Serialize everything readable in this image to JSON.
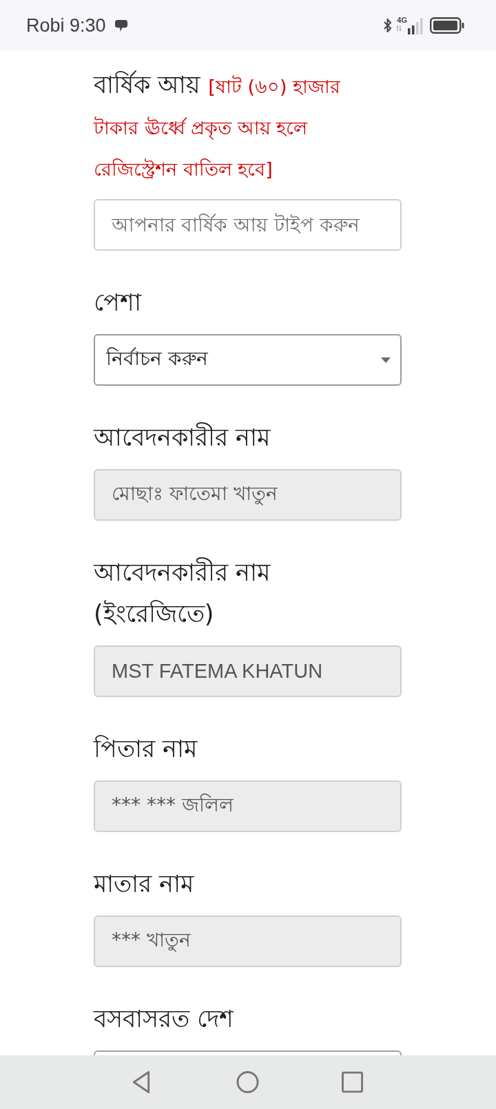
{
  "status_bar": {
    "carrier_time": "Robi 9:30",
    "network": "4G"
  },
  "form": {
    "fields": [
      {
        "label": "বার্ষিক আয়",
        "note": "[ষাট (৬০) হাজার টাকার ঊর্ধ্বে প্রকৃত আয় হলে রেজিস্ট্রেশন বাতিল হবে]",
        "input": {
          "kind": "text",
          "placeholder": "আপনার বার্ষিক আয় টাইপ করুন",
          "disabled": false
        }
      },
      {
        "label": "পেশা",
        "input": {
          "kind": "select",
          "value": "নির্বাচন করুন",
          "disabled": false
        }
      },
      {
        "label": "আবেদনকারীর নাম",
        "input": {
          "kind": "text",
          "value": "মোছাঃ ফাতেমা খাতুন",
          "disabled": true
        }
      },
      {
        "label": "আবেদনকারীর নাম (ইংরেজিতে)",
        "input": {
          "kind": "text",
          "value": "MST FATEMA KHATUN",
          "disabled": true
        }
      },
      {
        "label": "পিতার নাম",
        "input": {
          "kind": "text",
          "value": "*** *** জলিল",
          "disabled": true
        }
      },
      {
        "label": "মাতার নাম",
        "input": {
          "kind": "text",
          "value": "*** খাতুন",
          "disabled": true
        }
      },
      {
        "label": "বসবাসরত দেশ",
        "input": {
          "kind": "partial"
        }
      }
    ]
  }
}
